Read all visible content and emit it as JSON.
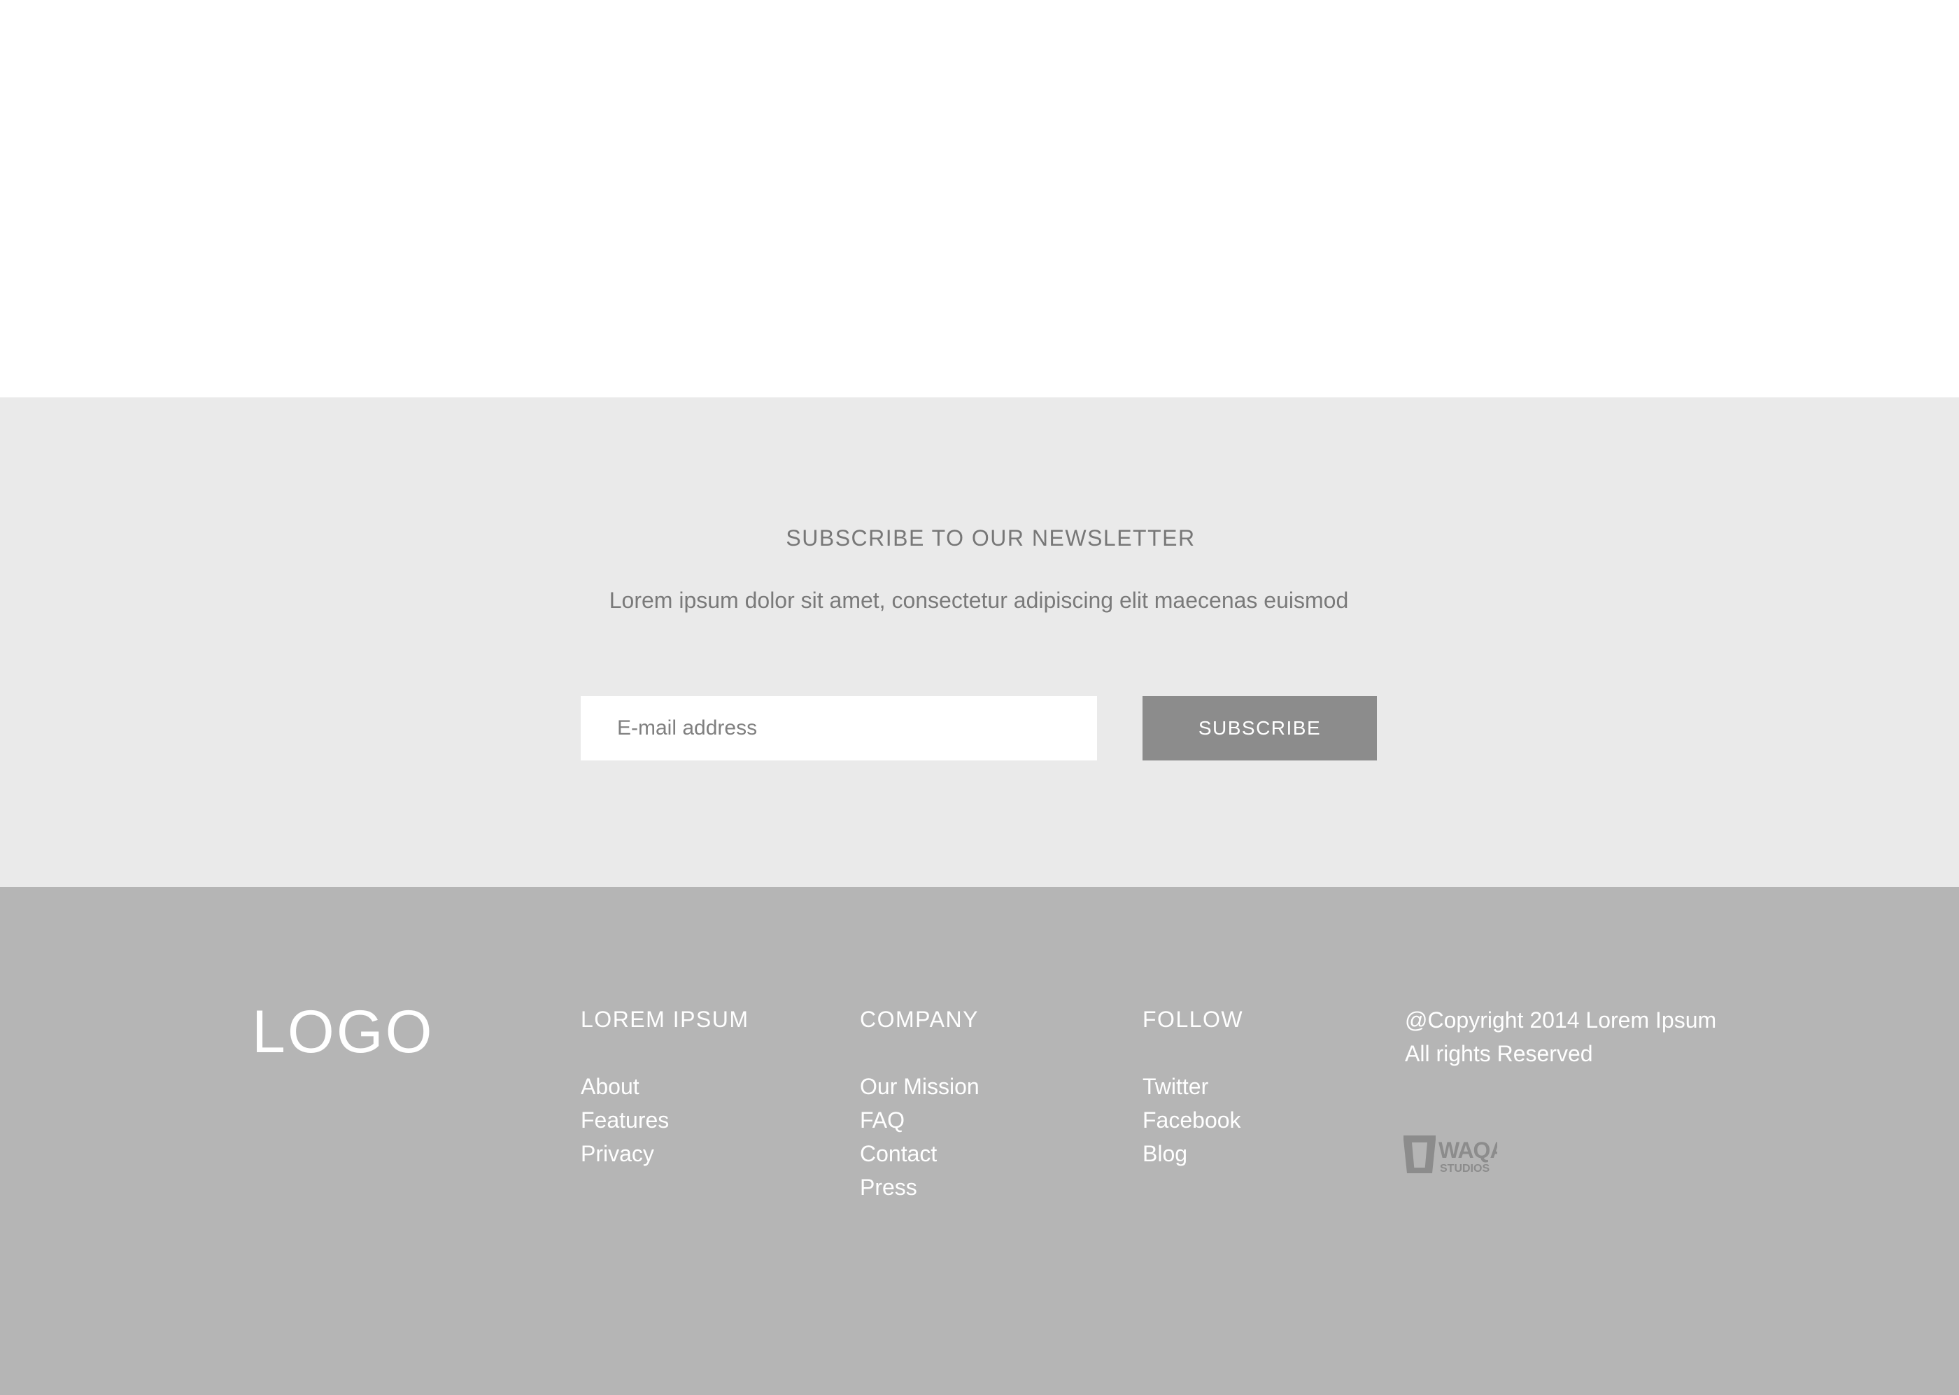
{
  "newsletter": {
    "heading": "SUBSCRIBE TO OUR NEWSLETTER",
    "description": "Lorem ipsum dolor sit amet, consectetur adipiscing elit maecenas euismod",
    "email_placeholder": "E-mail address",
    "subscribe_label": "SUBSCRIBE"
  },
  "footer": {
    "logo_text": "LOGO",
    "columns": [
      {
        "heading": "LOREM IPSUM",
        "links": [
          "About",
          "Features",
          "Privacy"
        ]
      },
      {
        "heading": "COMPANY",
        "links": [
          "Our Mission",
          "FAQ",
          "Contact",
          "Press"
        ]
      },
      {
        "heading": "FOLLOW",
        "links": [
          "Twitter",
          "Facebook",
          "Blog"
        ]
      }
    ],
    "copyright_line1": "@Copyright 2014 Lorem Ipsum",
    "copyright_line2": "All rights Reserved",
    "studio_logo": {
      "icon": "waqa-studios-logo",
      "text_top": "WAQA",
      "text_bottom": "STUDIOS"
    }
  },
  "colors": {
    "newsletter_bg": "#eaeaea",
    "footer_bg": "#b5b5b5",
    "button_bg": "#8c8c8c",
    "heading_text": "#777777",
    "footer_text": "#ffffff"
  }
}
